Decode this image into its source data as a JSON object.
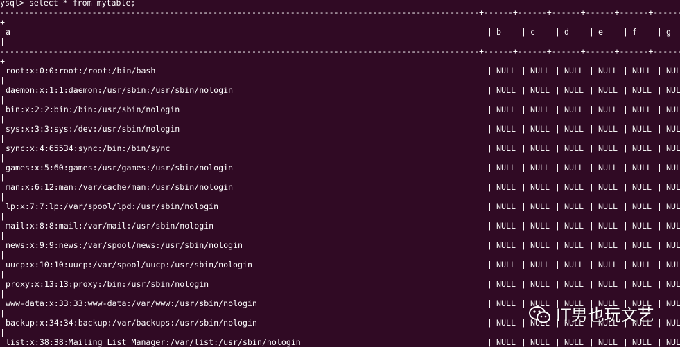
{
  "terminal": {
    "prompt_line": "ysql> select * from mytable;",
    "border_line": "---------------------------------------------------------------------------------------------------+------+------+------+------+------+------+",
    "border_wrap": "+",
    "pipe": "|",
    "columns": [
      "a",
      "b",
      "c",
      "d",
      "e",
      "f",
      "g"
    ],
    "rows": [
      {
        "a": "root:x:0:0:root:/root:/bin/bash",
        "vals": [
          "NULL",
          "NULL",
          "NULL",
          "NULL",
          "NULL",
          "NUL"
        ]
      },
      {
        "a": "daemon:x:1:1:daemon:/usr/sbin:/usr/sbin/nologin",
        "vals": [
          "NULL",
          "NULL",
          "NULL",
          "NULL",
          "NULL",
          "NUL"
        ]
      },
      {
        "a": "bin:x:2:2:bin:/bin:/usr/sbin/nologin",
        "vals": [
          "NULL",
          "NULL",
          "NULL",
          "NULL",
          "NULL",
          "NUL"
        ]
      },
      {
        "a": "sys:x:3:3:sys:/dev:/usr/sbin/nologin",
        "vals": [
          "NULL",
          "NULL",
          "NULL",
          "NULL",
          "NULL",
          "NUL"
        ]
      },
      {
        "a": "sync:x:4:65534:sync:/bin:/bin/sync",
        "vals": [
          "NULL",
          "NULL",
          "NULL",
          "NULL",
          "NULL",
          "NUL"
        ]
      },
      {
        "a": "games:x:5:60:games:/usr/games:/usr/sbin/nologin",
        "vals": [
          "NULL",
          "NULL",
          "NULL",
          "NULL",
          "NULL",
          "NUL"
        ]
      },
      {
        "a": "man:x:6:12:man:/var/cache/man:/usr/sbin/nologin",
        "vals": [
          "NULL",
          "NULL",
          "NULL",
          "NULL",
          "NULL",
          "NUL"
        ]
      },
      {
        "a": "lp:x:7:7:lp:/var/spool/lpd:/usr/sbin/nologin",
        "vals": [
          "NULL",
          "NULL",
          "NULL",
          "NULL",
          "NULL",
          "NUL"
        ]
      },
      {
        "a": "mail:x:8:8:mail:/var/mail:/usr/sbin/nologin",
        "vals": [
          "NULL",
          "NULL",
          "NULL",
          "NULL",
          "NULL",
          "NUL"
        ]
      },
      {
        "a": "news:x:9:9:news:/var/spool/news:/usr/sbin/nologin",
        "vals": [
          "NULL",
          "NULL",
          "NULL",
          "NULL",
          "NULL",
          "NUL"
        ]
      },
      {
        "a": "uucp:x:10:10:uucp:/var/spool/uucp:/usr/sbin/nologin",
        "vals": [
          "NULL",
          "NULL",
          "NULL",
          "NULL",
          "NULL",
          "NUL"
        ]
      },
      {
        "a": "proxy:x:13:13:proxy:/bin:/usr/sbin/nologin",
        "vals": [
          "NULL",
          "NULL",
          "NULL",
          "NULL",
          "NULL",
          "NUL"
        ]
      },
      {
        "a": "www-data:x:33:33:www-data:/var/www:/usr/sbin/nologin",
        "vals": [
          "NULL",
          "NULL",
          "NULL",
          "NULL",
          "NULL",
          "NUL"
        ]
      },
      {
        "a": "backup:x:34:34:backup:/var/backups:/usr/sbin/nologin",
        "vals": [
          "NULL",
          "NULL",
          "NULL",
          "NULL",
          "NULL",
          "NUL"
        ]
      },
      {
        "a": "list:x:38:38:Mailing List Manager:/var/list:/usr/sbin/nologin",
        "vals": [
          "NULL",
          "NULL",
          "NULL",
          "NULL",
          "NULL",
          "NUL"
        ]
      }
    ]
  },
  "watermark": {
    "text": "IT男也玩文艺",
    "icon": "wechat-icon"
  },
  "colors": {
    "background": "#300a24",
    "text": "#ffffff"
  }
}
